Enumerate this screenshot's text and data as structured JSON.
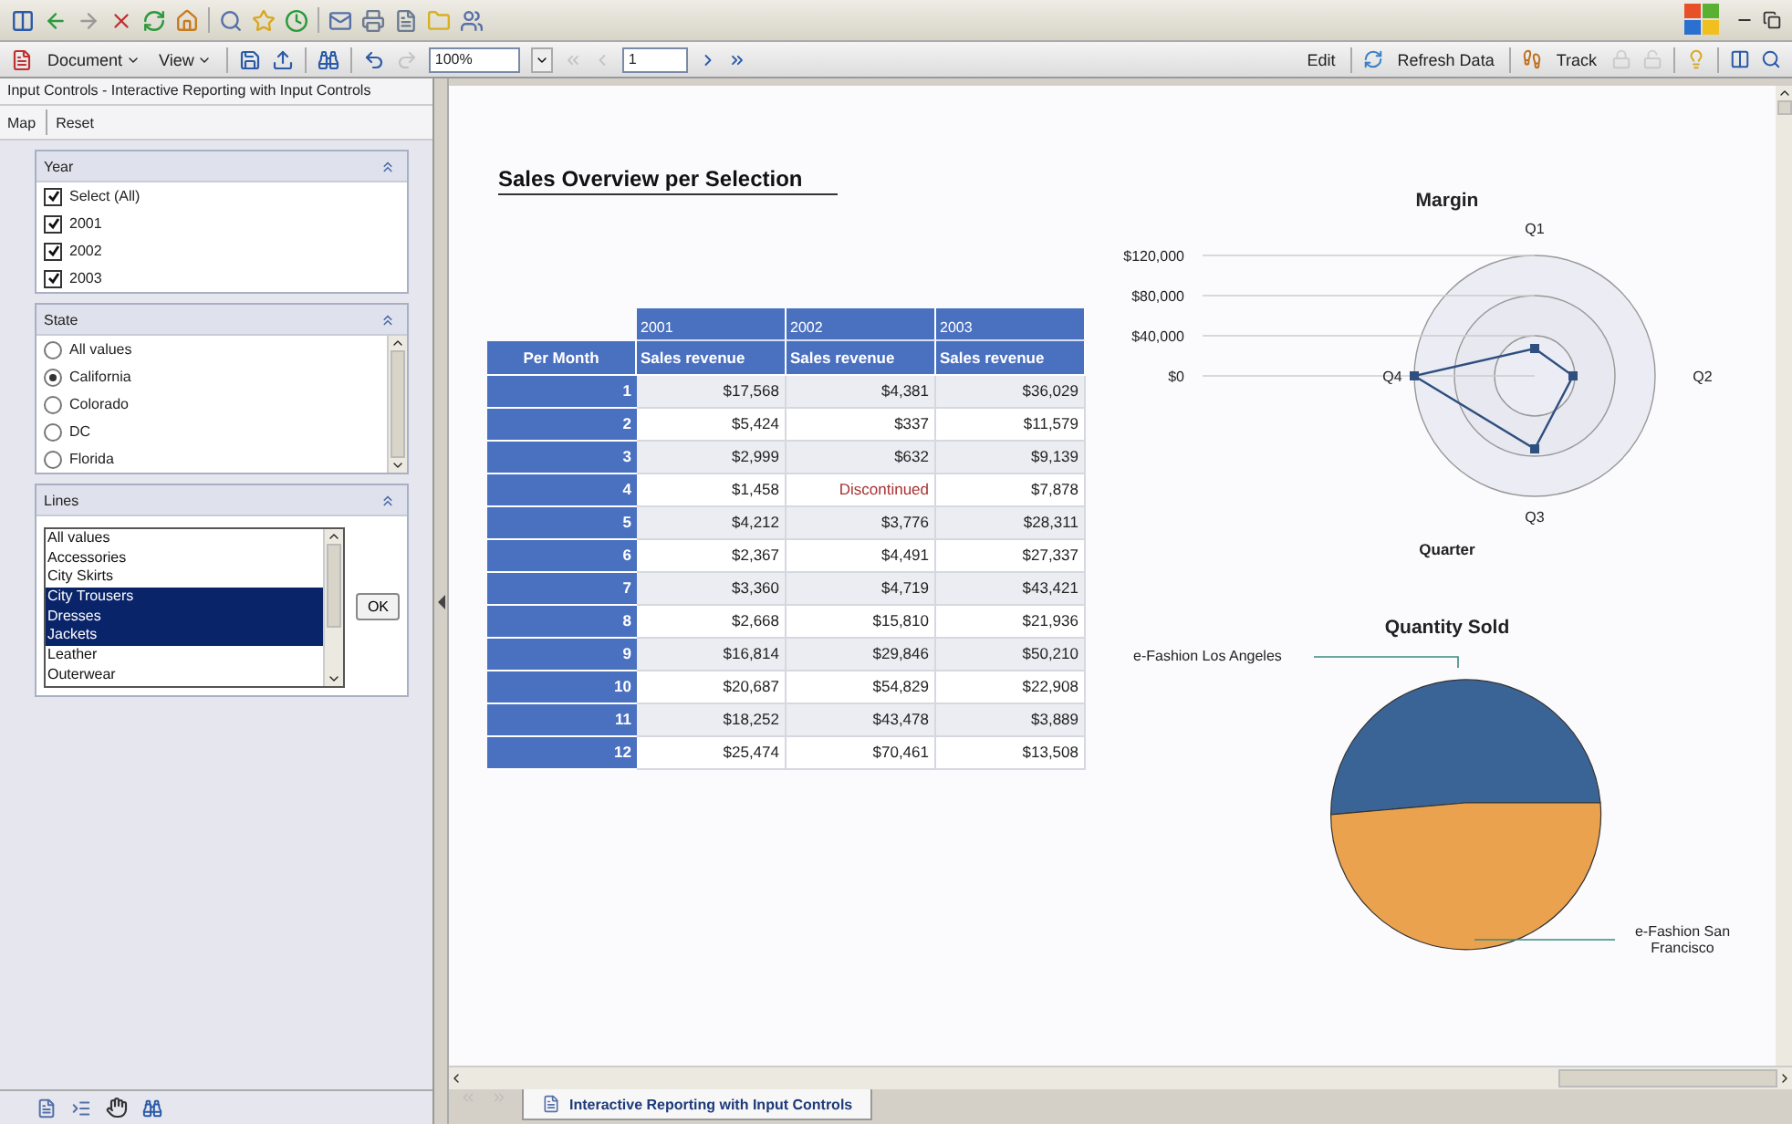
{
  "toolbar": {
    "menus": [
      {
        "label": "Document"
      },
      {
        "label": "View"
      }
    ],
    "zoom": "100%",
    "page": "1",
    "actions": [
      {
        "label": "Edit",
        "kind": "plain"
      },
      {
        "label": "Refresh Data",
        "kind": "refresh"
      },
      {
        "label": "Track",
        "kind": "track"
      }
    ]
  },
  "input_controls": {
    "title": "Input Controls - Interactive Reporting with Input Controls",
    "links": [
      "Map",
      "Reset"
    ],
    "year": {
      "title": "Year",
      "options": [
        {
          "label": "Select (All)",
          "checked": true
        },
        {
          "label": "2001",
          "checked": true
        },
        {
          "label": "2002",
          "checked": true
        },
        {
          "label": "2003",
          "checked": true
        }
      ]
    },
    "state": {
      "title": "State",
      "options": [
        {
          "label": "All values",
          "selected": false
        },
        {
          "label": "California",
          "selected": true
        },
        {
          "label": "Colorado",
          "selected": false
        },
        {
          "label": "DC",
          "selected": false
        },
        {
          "label": "Florida",
          "selected": false
        }
      ]
    },
    "lines": {
      "title": "Lines",
      "options": [
        {
          "label": "All values",
          "selected": false
        },
        {
          "label": "Accessories",
          "selected": false
        },
        {
          "label": "City Skirts",
          "selected": false
        },
        {
          "label": "City Trousers",
          "selected": true
        },
        {
          "label": "Dresses",
          "selected": true
        },
        {
          "label": "Jackets",
          "selected": true
        },
        {
          "label": "Leather",
          "selected": false
        },
        {
          "label": "Outerwear",
          "selected": false
        }
      ],
      "button": "OK"
    }
  },
  "report": {
    "title": "Sales Overview per Selection",
    "table": {
      "row_header": "Per Month",
      "columns": [
        {
          "year": "2001",
          "measure": "Sales revenue"
        },
        {
          "year": "2002",
          "measure": "Sales revenue"
        },
        {
          "year": "2003",
          "measure": "Sales revenue"
        }
      ],
      "rows": [
        {
          "month": "1",
          "cells": [
            {
              "text": "$17,568",
              "kind": "value"
            },
            {
              "text": "$4,381",
              "kind": "value"
            },
            {
              "text": "$36,029",
              "kind": "value"
            }
          ]
        },
        {
          "month": "2",
          "cells": [
            {
              "text": "$5,424",
              "kind": "value"
            },
            {
              "text": "$337",
              "kind": "value"
            },
            {
              "text": "$11,579",
              "kind": "value"
            }
          ]
        },
        {
          "month": "3",
          "cells": [
            {
              "text": "$2,999",
              "kind": "value"
            },
            {
              "text": "$632",
              "kind": "value"
            },
            {
              "text": "$9,139",
              "kind": "value"
            }
          ]
        },
        {
          "month": "4",
          "cells": [
            {
              "text": "$1,458",
              "kind": "value"
            },
            {
              "text": "Discontinued",
              "kind": "note"
            },
            {
              "text": "$7,878",
              "kind": "value"
            }
          ]
        },
        {
          "month": "5",
          "cells": [
            {
              "text": "$4,212",
              "kind": "value"
            },
            {
              "text": "$3,776",
              "kind": "value"
            },
            {
              "text": "$28,311",
              "kind": "value"
            }
          ]
        },
        {
          "month": "6",
          "cells": [
            {
              "text": "$2,367",
              "kind": "value"
            },
            {
              "text": "$4,491",
              "kind": "value"
            },
            {
              "text": "$27,337",
              "kind": "value"
            }
          ]
        },
        {
          "month": "7",
          "cells": [
            {
              "text": "$3,360",
              "kind": "value"
            },
            {
              "text": "$4,719",
              "kind": "value"
            },
            {
              "text": "$43,421",
              "kind": "value"
            }
          ]
        },
        {
          "month": "8",
          "cells": [
            {
              "text": "$2,668",
              "kind": "value"
            },
            {
              "text": "$15,810",
              "kind": "value"
            },
            {
              "text": "$21,936",
              "kind": "value"
            }
          ]
        },
        {
          "month": "9",
          "cells": [
            {
              "text": "$16,814",
              "kind": "value"
            },
            {
              "text": "$29,846",
              "kind": "value"
            },
            {
              "text": "$50,210",
              "kind": "value"
            }
          ]
        },
        {
          "month": "10",
          "cells": [
            {
              "text": "$20,687",
              "kind": "value"
            },
            {
              "text": "$54,829",
              "kind": "value"
            },
            {
              "text": "$22,908",
              "kind": "value"
            }
          ]
        },
        {
          "month": "11",
          "cells": [
            {
              "text": "$18,252",
              "kind": "value"
            },
            {
              "text": "$43,478",
              "kind": "value"
            },
            {
              "text": "$3,889",
              "kind": "value"
            }
          ]
        },
        {
          "month": "12",
          "cells": [
            {
              "text": "$25,474",
              "kind": "value"
            },
            {
              "text": "$70,461",
              "kind": "value"
            },
            {
              "text": "$13,508",
              "kind": "value"
            }
          ]
        }
      ]
    },
    "margin_chart": {
      "title": "Margin",
      "axis_label": "Quarter",
      "ring_labels": [
        "$120,000",
        "$80,000",
        "$40,000",
        "$0"
      ],
      "spokes": [
        "Q1",
        "Q2",
        "Q3",
        "Q4"
      ]
    },
    "quantity_chart": {
      "title": "Quantity Sold",
      "slices": [
        {
          "label": "e-Fashion Los Angeles",
          "color": "#3b6496"
        },
        {
          "label": "e-Fashion San Francisco",
          "color": "#eba24e"
        }
      ]
    }
  },
  "tabs": [
    {
      "label": "Interactive Reporting with Input Controls",
      "selected": true
    }
  ]
}
